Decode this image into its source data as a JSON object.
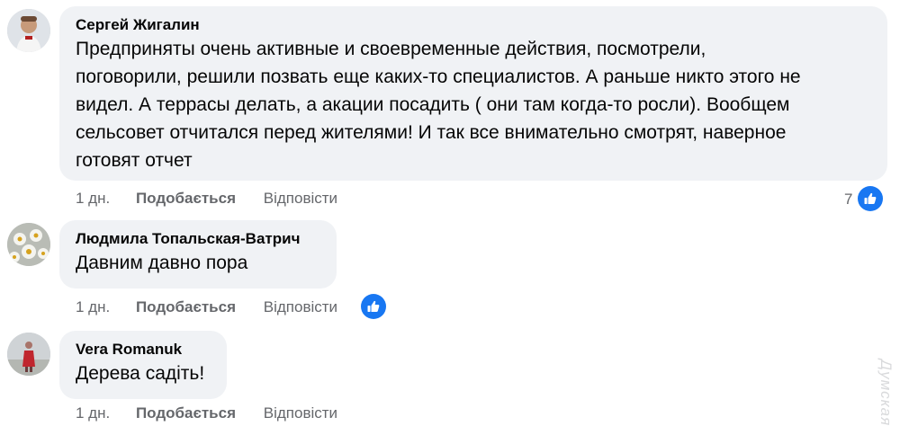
{
  "comments": [
    {
      "author": "Сергей Жигалин",
      "text_lines": [
        "Предприняты очень активные и своевременные действия, посмотрели,",
        "поговорили, решили позвать еще каких-то специалистов. А раньше никто этого не",
        "видел. А террасы делать, а акации посадить ( они там когда-то росли). Вообщем",
        "сельсовет отчитался перед жителями! И так все внимательно смотрят, наверное",
        "готовят отчет"
      ],
      "time": "1 дн.",
      "like_label": "Подобається",
      "reply_label": "Відповісти",
      "reactions_count": "7"
    },
    {
      "author": "Людмила Топальская-Ватрич",
      "text": "Давним давно пора",
      "time": "1 дн.",
      "like_label": "Подобається",
      "reply_label": "Відповісти"
    },
    {
      "author": "Vera Romanuk",
      "text": "Дерева садіть!",
      "time": "1 дн.",
      "like_label": "Подобається",
      "reply_label": "Відповісти"
    }
  ],
  "watermark": "Думская",
  "colors": {
    "bubble": "#f0f2f5",
    "meta_text": "#65676b",
    "like_blue": "#1877f2"
  },
  "icons": [
    "avatar-photo",
    "like-thumb-icon"
  ]
}
